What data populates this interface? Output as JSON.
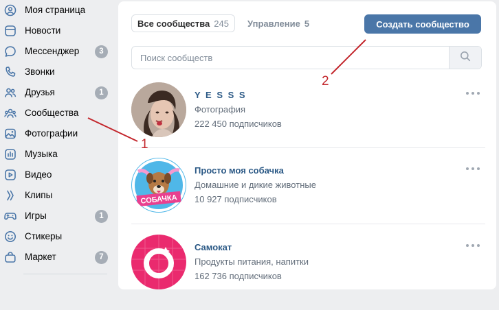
{
  "sidebar": {
    "items": [
      {
        "label": "Моя страница",
        "icon": "user-circle-icon"
      },
      {
        "label": "Новости",
        "icon": "news-icon"
      },
      {
        "label": "Мессенджер",
        "icon": "message-icon",
        "badge": "3"
      },
      {
        "label": "Звонки",
        "icon": "phone-icon"
      },
      {
        "label": "Друзья",
        "icon": "friends-icon",
        "badge": "1"
      },
      {
        "label": "Сообщества",
        "icon": "communities-icon"
      },
      {
        "label": "Фотографии",
        "icon": "photo-icon"
      },
      {
        "label": "Музыка",
        "icon": "music-icon"
      },
      {
        "label": "Видео",
        "icon": "video-icon"
      },
      {
        "label": "Клипы",
        "icon": "clips-icon"
      },
      {
        "label": "Игры",
        "icon": "gamepad-icon",
        "badge": "1"
      },
      {
        "label": "Стикеры",
        "icon": "sticker-icon"
      },
      {
        "label": "Маркет",
        "icon": "market-icon",
        "badge": "7"
      }
    ]
  },
  "tabs": {
    "all": {
      "label": "Все сообщества",
      "count": "245"
    },
    "manage": {
      "label": "Управление",
      "count": "5"
    }
  },
  "create_button": {
    "label": "Создать сообщество"
  },
  "search": {
    "placeholder": "Поиск сообществ",
    "value": "",
    "icon": "search-icon"
  },
  "groups": [
    {
      "name": "Y E S S S",
      "category": "Фотография",
      "subscribers": "222 450 подписчиков"
    },
    {
      "name": "Просто моя собачка",
      "category": "Домашние и дикие животные",
      "subscribers": "10 927 подписчиков",
      "avatar_text": "СОБАЧКА"
    },
    {
      "name": "Самокат",
      "category": "Продукты питания, напитки",
      "subscribers": "162 736 подписчиков"
    }
  ],
  "annotations": {
    "first": "1",
    "second": "2"
  },
  "colors": {
    "accent": "#4a76a8",
    "link": "#2a5885",
    "annotation": "#c3262c",
    "badge": "#a6adb6",
    "icon": "#4a76a8"
  }
}
